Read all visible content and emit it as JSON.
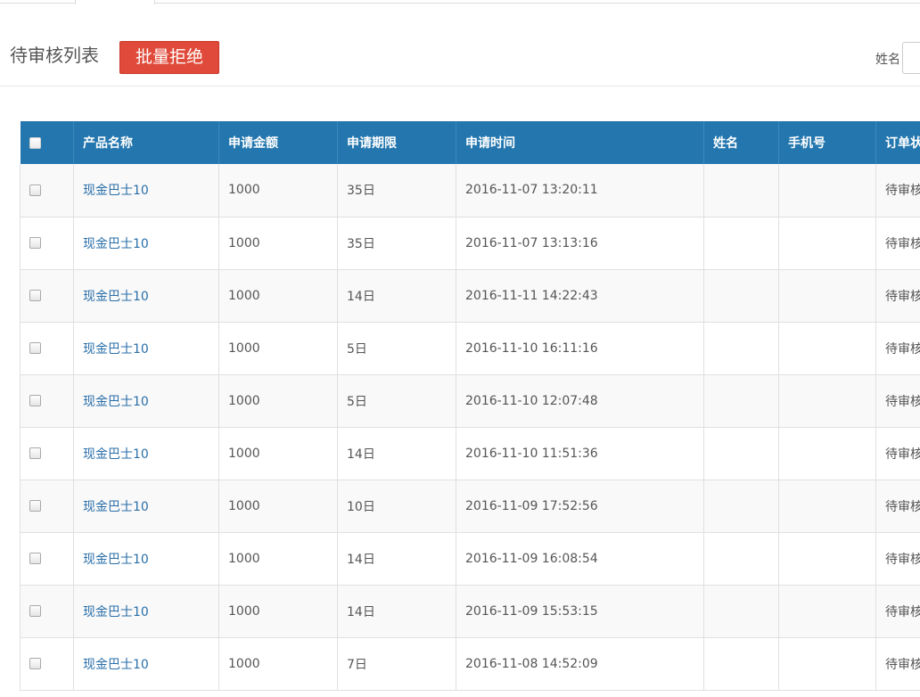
{
  "header": {
    "title": "待审核列表",
    "batch_reject_label": "批量拒绝",
    "name_filter_label": "姓名",
    "name_filter_value": ""
  },
  "table": {
    "columns": [
      "产品名称",
      "申请金额",
      "申请期限",
      "申请时间",
      "姓名",
      "手机号",
      "订单状态"
    ],
    "rows": [
      {
        "product": "现金巴士10",
        "amount": "1000",
        "term": "35日",
        "time": "2016-11-07 13:20:11",
        "name": "",
        "phone": "",
        "status": "待审核"
      },
      {
        "product": "现金巴士10",
        "amount": "1000",
        "term": "35日",
        "time": "2016-11-07 13:13:16",
        "name": "",
        "phone": "",
        "status": "待审核"
      },
      {
        "product": "现金巴士10",
        "amount": "1000",
        "term": "14日",
        "time": "2016-11-11 14:22:43",
        "name": "",
        "phone": "",
        "status": "待审核"
      },
      {
        "product": "现金巴士10",
        "amount": "1000",
        "term": "5日",
        "time": "2016-11-10 16:11:16",
        "name": "",
        "phone": "",
        "status": "待审核"
      },
      {
        "product": "现金巴士10",
        "amount": "1000",
        "term": "5日",
        "time": "2016-11-10 12:07:48",
        "name": "",
        "phone": "",
        "status": "待审核"
      },
      {
        "product": "现金巴士10",
        "amount": "1000",
        "term": "14日",
        "time": "2016-11-10 11:51:36",
        "name": "",
        "phone": "",
        "status": "待审核"
      },
      {
        "product": "现金巴士10",
        "amount": "1000",
        "term": "10日",
        "time": "2016-11-09 17:52:56",
        "name": "",
        "phone": "",
        "status": "待审核"
      },
      {
        "product": "现金巴士10",
        "amount": "1000",
        "term": "14日",
        "time": "2016-11-09 16:08:54",
        "name": "",
        "phone": "",
        "status": "待审核"
      },
      {
        "product": "现金巴士10",
        "amount": "1000",
        "term": "14日",
        "time": "2016-11-09 15:53:15",
        "name": "",
        "phone": "",
        "status": "待审核"
      },
      {
        "product": "现金巴士10",
        "amount": "1000",
        "term": "7日",
        "time": "2016-11-08 14:52:09",
        "name": "",
        "phone": "",
        "status": "待审核"
      }
    ]
  },
  "colors": {
    "header_bg": "#2477ae",
    "reject_button": "#e04a3a",
    "link": "#2a6fa8"
  }
}
